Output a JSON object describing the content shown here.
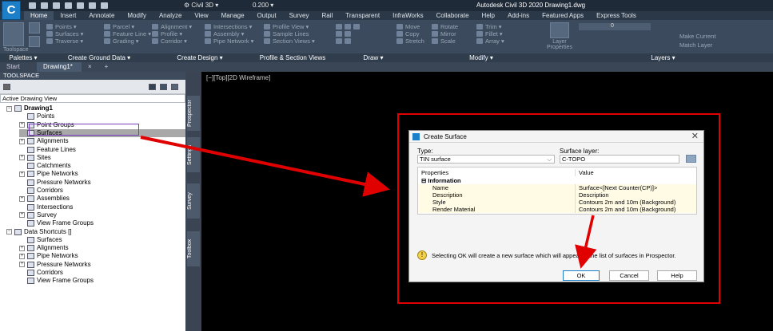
{
  "titlebar": {
    "app_letter": "C",
    "workspace": "Civil 3D",
    "zoom": "0.200",
    "window_title": "Autodesk Civil 3D 2020  Drawing1.dwg"
  },
  "ribbon_tabs": [
    "Home",
    "Insert",
    "Annotate",
    "Modify",
    "Analyze",
    "View",
    "Manage",
    "Output",
    "Survey",
    "Rail",
    "Transparent",
    "InfraWorks",
    "Collaborate",
    "Help",
    "Add-ins",
    "Featured Apps",
    "Express Tools"
  ],
  "ribbon": {
    "toolspace_btn": "Toolspace",
    "col1": [
      "Points ▾",
      "Surfaces ▾",
      "Traverse ▾"
    ],
    "col2": [
      "Parcel ▾",
      "Feature Line ▾",
      "Grading ▾"
    ],
    "col3": [
      "Alignment ▾",
      "Profile ▾",
      "Corridor ▾"
    ],
    "col4": [
      "Intersections ▾",
      "Assembly ▾",
      "Pipe Network ▾"
    ],
    "col5": [
      "Profile View ▾",
      "Sample Lines",
      "Section Views ▾"
    ],
    "col7": [
      "Move",
      "Copy",
      "Stretch"
    ],
    "col8": [
      "Rotate",
      "Mirror",
      "Scale"
    ],
    "col9": [
      "Trim ▾",
      "Fillet ▾",
      "Array ▾"
    ],
    "layer_btn": "Layer Properties",
    "layer_value": "0",
    "layer_actions": [
      "Make Current",
      "Match Layer"
    ]
  },
  "panels": [
    "Palettes ▾",
    "Create Ground Data ▾",
    "Create Design ▾",
    "Profile & Section Views",
    "Draw ▾",
    "Modify ▾",
    "Layers ▾"
  ],
  "doctabs": {
    "start": "Start",
    "drawing": "Drawing1*",
    "close": "×",
    "add": "+"
  },
  "toolspace": {
    "title": "TOOLSPACE",
    "view": "Active Drawing View",
    "side_tabs": [
      "Prospector",
      "Settings",
      "Survey",
      "Toolbox"
    ]
  },
  "tree": [
    {
      "label": "Drawing1",
      "bold": true
    },
    {
      "label": "Points"
    },
    {
      "label": "Point Groups"
    },
    {
      "label": "Surfaces"
    },
    {
      "label": "Alignments"
    },
    {
      "label": "Feature Lines"
    },
    {
      "label": "Sites"
    },
    {
      "label": "Catchments"
    },
    {
      "label": "Pipe Networks"
    },
    {
      "label": "Pressure Networks"
    },
    {
      "label": "Corridors"
    },
    {
      "label": "Assemblies"
    },
    {
      "label": "Intersections"
    },
    {
      "label": "Survey"
    },
    {
      "label": "View Frame Groups"
    },
    {
      "label": "Data Shortcuts []"
    },
    {
      "label": "Surfaces"
    },
    {
      "label": "Alignments"
    },
    {
      "label": "Pipe Networks"
    },
    {
      "label": "Pressure Networks"
    },
    {
      "label": "Corridors"
    },
    {
      "label": "View Frame Groups"
    }
  ],
  "viewport": {
    "label": "[−][Top][2D Wireframe]"
  },
  "dialog": {
    "title": "Create Surface",
    "type_label": "Type:",
    "type_value": "TIN surface",
    "layer_label": "Surface layer:",
    "layer_value": "C-TOPO",
    "col_properties": "Properties",
    "col_value": "Value",
    "section": "Information",
    "rows": [
      {
        "name": "Name",
        "value": "Surface<[Next Counter(CP)]>"
      },
      {
        "name": "Description",
        "value": "Description"
      },
      {
        "name": "Style",
        "value": "Contours 2m and 10m (Background)"
      },
      {
        "name": "Render Material",
        "value": "Contours 2m and 10m (Background)"
      }
    ],
    "info": "Selecting OK will create a new surface which will appear in the list of surfaces in Prospector.",
    "ok": "OK",
    "cancel": "Cancel",
    "help": "Help"
  },
  "colors": {
    "annotation_red": "#e00000",
    "selection_purple": "#7a3fbf",
    "accent": "#1d7fc8"
  }
}
